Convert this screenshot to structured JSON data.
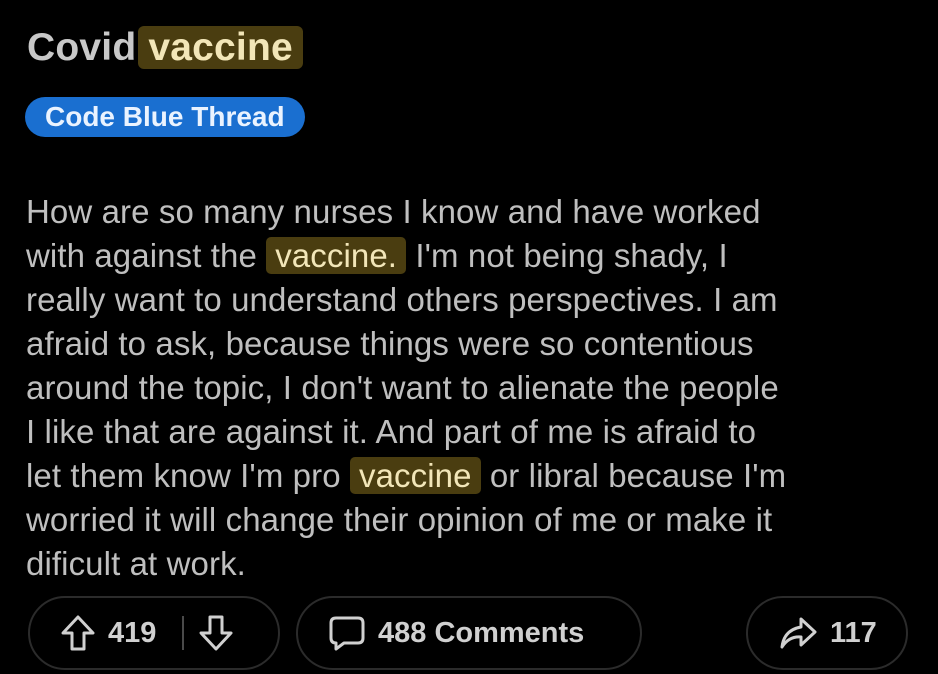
{
  "post": {
    "title_prefix": "Covid",
    "title_highlight": "vaccine",
    "flair": "Code Blue Thread",
    "body_lines": [
      {
        "before": "How are so many nurses I know and have worked",
        "highlight": "",
        "after": ""
      },
      {
        "before": "with against the",
        "highlight": "vaccine.",
        "after": "I'm not being shady, I"
      },
      {
        "before": "really want to understand others perspectives. I am",
        "highlight": "",
        "after": ""
      },
      {
        "before": "afraid to ask, because things were so contentious",
        "highlight": "",
        "after": ""
      },
      {
        "before": "around the topic, I don't want to alienate the people",
        "highlight": "",
        "after": ""
      },
      {
        "before": "I like that are against it. And part of me is afraid to",
        "highlight": "",
        "after": ""
      },
      {
        "before": "let them know I'm pro",
        "highlight": "vaccine",
        "after": "or libral because I'm"
      },
      {
        "before": "worried it will change their opinion of me or make it",
        "highlight": "",
        "after": ""
      },
      {
        "before": "dificult at work.",
        "highlight": "",
        "after": ""
      }
    ]
  },
  "actions": {
    "upvote_count": "419",
    "comments_label": "488 Comments",
    "share_count": "117"
  },
  "icons": {
    "upvote": "arrow-up-icon",
    "downvote": "arrow-down-icon",
    "comments": "speech-bubble-icon",
    "share": "share-arrow-icon"
  },
  "colors": {
    "background": "#000000",
    "highlight_bg": "#4a3d10",
    "highlight_text": "#f2e6b8",
    "flair_bg": "#1a6fd0",
    "text": "#bfbfbf"
  }
}
